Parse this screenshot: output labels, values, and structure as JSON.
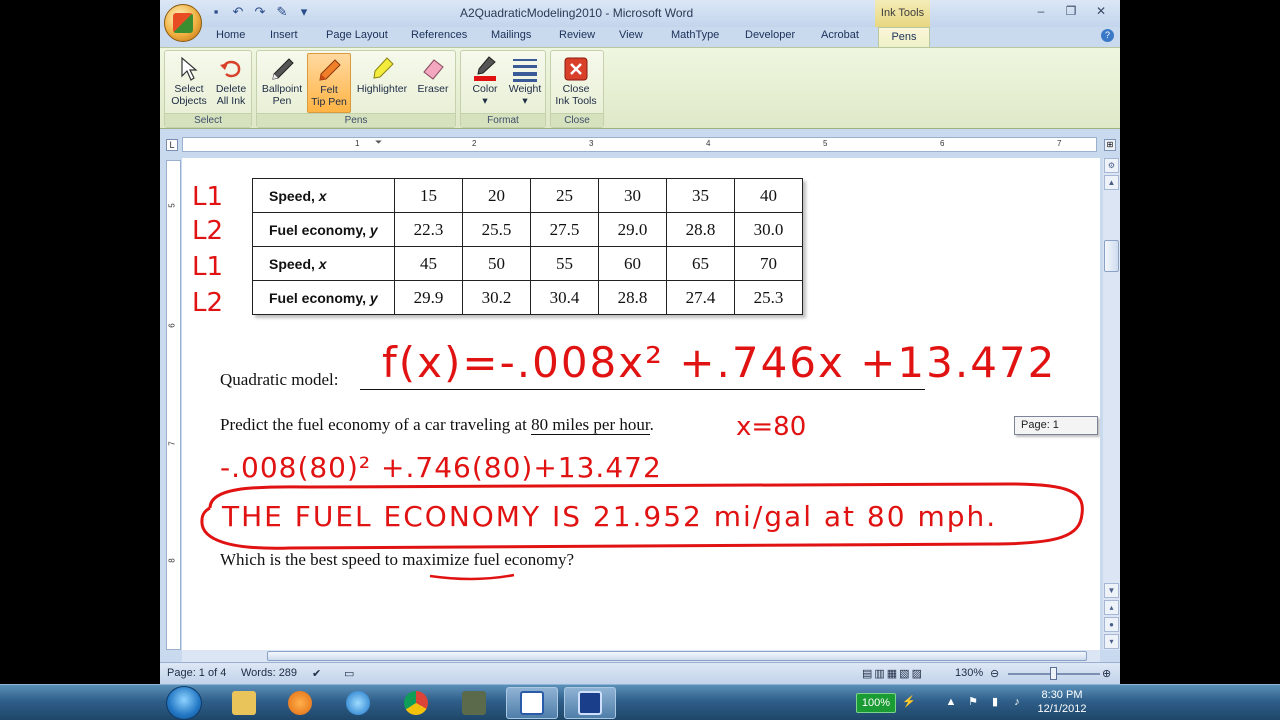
{
  "window": {
    "title": "A2QuadraticModeling2010 - Microsoft Word",
    "context_tab_group": "Ink Tools"
  },
  "tabs": [
    "Home",
    "Insert",
    "Page Layout",
    "References",
    "Mailings",
    "Review",
    "View",
    "MathType",
    "Developer",
    "Acrobat",
    "Pens"
  ],
  "ribbon": {
    "groups": {
      "select": "Select",
      "pens": "Pens",
      "format": "Format",
      "close": "Close"
    },
    "buttons": {
      "select_objects": [
        "Select",
        "Objects"
      ],
      "delete_all_ink": [
        "Delete",
        "All Ink"
      ],
      "ballpoint_pen": [
        "Ballpoint",
        "Pen"
      ],
      "felt_tip_pen": [
        "Felt",
        "Tip Pen"
      ],
      "highlighter": [
        "Highlighter"
      ],
      "eraser": [
        "Eraser"
      ],
      "color": [
        "Color"
      ],
      "weight": [
        "Weight"
      ],
      "close_ink_tools": [
        "Close",
        "Ink Tools"
      ]
    }
  },
  "ruler": {
    "h_numbers": [
      "1",
      "2",
      "3",
      "4",
      "5",
      "6",
      "7"
    ],
    "v_numbers": [
      "5",
      "6",
      "7",
      "8"
    ],
    "corner": "L"
  },
  "table": {
    "rows": [
      {
        "label": "Speed, x",
        "kind": "speed",
        "values": [
          "15",
          "20",
          "25",
          "30",
          "35",
          "40"
        ],
        "ink": "L1"
      },
      {
        "label": "Fuel economy, y",
        "kind": "fuel",
        "values": [
          "22.3",
          "25.5",
          "27.5",
          "29.0",
          "28.8",
          "30.0"
        ],
        "ink": "L2"
      },
      {
        "label": "Speed, x",
        "kind": "speed",
        "values": [
          "45",
          "50",
          "55",
          "60",
          "65",
          "70"
        ],
        "ink": "L1"
      },
      {
        "label": "Fuel economy, y",
        "kind": "fuel",
        "values": [
          "29.9",
          "30.2",
          "30.4",
          "28.8",
          "27.4",
          "25.3"
        ],
        "ink": "L2"
      }
    ]
  },
  "document": {
    "model_label": "Quadratic model:",
    "predict_before": "Predict the fuel economy of a car traveling at ",
    "predict_underlined": "80 miles per hour",
    "predict_after": ".",
    "best_before": "Which is the best speed to ",
    "best_underlined": "maximize",
    "best_after": " fuel economy?"
  },
  "ink": {
    "model": "f(x)=-.008x² +.746x +13.472",
    "x_value": "x=80",
    "substitution": "-.008(80)² +.746(80)+13.472",
    "answer": "THE FUEL ECONOMY IS 21.952 mi/gal at 80 mph."
  },
  "page_tooltip": "Page: 1",
  "status": {
    "page": "Page: 1 of 4",
    "words": "Words: 289",
    "zoom": "130%"
  },
  "taskbar": {
    "battery": "100%",
    "time": "8:30 PM",
    "date": "12/1/2012"
  },
  "colors": {
    "ink": "#e01212",
    "speed_label": "#2f73b8",
    "fuel_label": "#1c9a60"
  }
}
